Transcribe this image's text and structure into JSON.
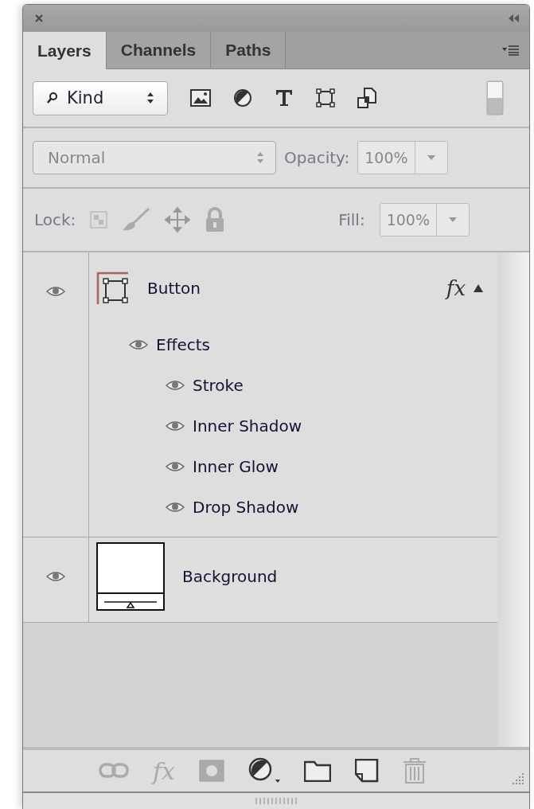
{
  "tabs": [
    {
      "label": "Layers",
      "selected": true
    },
    {
      "label": "Channels",
      "selected": false
    },
    {
      "label": "Paths",
      "selected": false
    }
  ],
  "filter": {
    "value": "Kind"
  },
  "blend": {
    "value": "Normal",
    "disabled": true,
    "opacity_label": "Opacity:",
    "opacity": "100%"
  },
  "lock": {
    "label": "Lock:",
    "disabled": true,
    "fill_label": "Fill:",
    "fill": "100%"
  },
  "layers": [
    {
      "name": "Button",
      "kind": "shape",
      "visible": true,
      "fx": "fx",
      "effects": {
        "name": "Effects",
        "visible": true,
        "children": [
          {
            "name": "Stroke",
            "visible": true
          },
          {
            "name": "Inner Shadow",
            "visible": true
          },
          {
            "name": "Inner Glow",
            "visible": true
          },
          {
            "name": "Drop Shadow",
            "visible": true
          }
        ]
      }
    },
    {
      "name": "Background",
      "kind": "image",
      "visible": true
    }
  ],
  "footer": [
    {
      "kind": "link",
      "disabled": true
    },
    {
      "kind": "fx",
      "label": "fx",
      "disabled": true
    },
    {
      "kind": "mask",
      "disabled": true
    },
    {
      "kind": "adjust",
      "disabled": false
    },
    {
      "kind": "folder",
      "disabled": false
    },
    {
      "kind": "new",
      "disabled": false
    },
    {
      "kind": "trash",
      "disabled": true
    }
  ]
}
